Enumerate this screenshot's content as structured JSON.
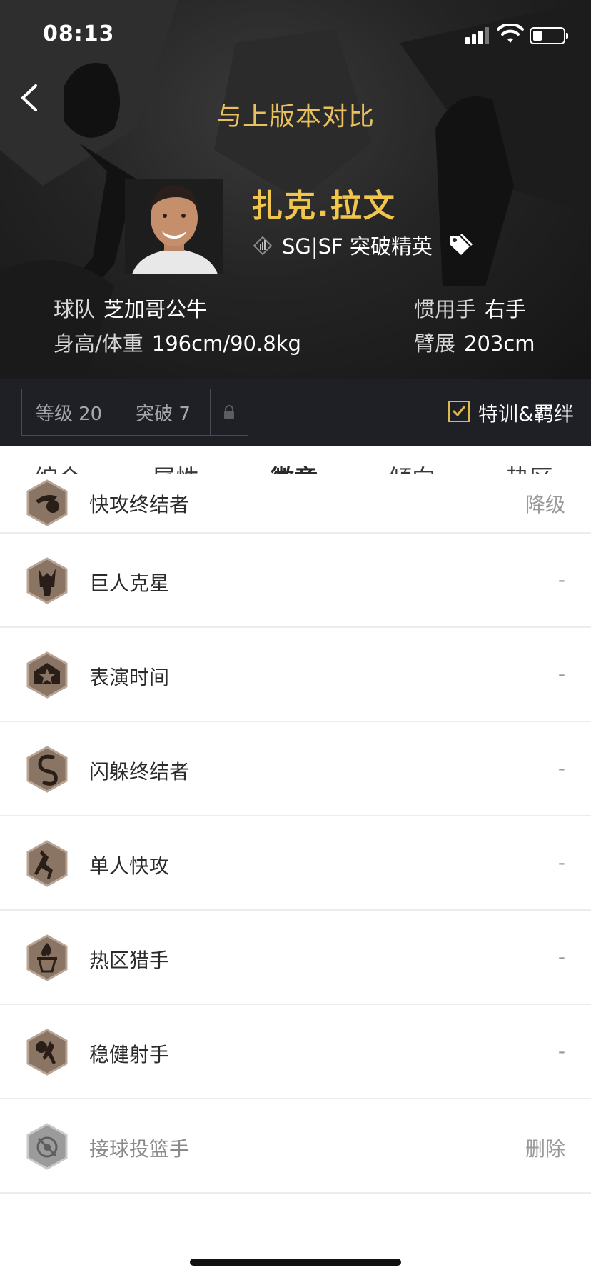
{
  "status_bar": {
    "time": "08:13"
  },
  "header": {
    "title": "与上版本对比",
    "player_name": "扎克.拉文",
    "position_text": "SG|SF 突破精英",
    "team_label": "球队",
    "team_value": "芝加哥公牛",
    "hw_label": "身高/体重",
    "hw_value": "196cm/90.8kg",
    "hand_label": "惯用手",
    "hand_value": "右手",
    "wingspan_label": "臂展",
    "wingspan_value": "203cm"
  },
  "level_bar": {
    "level": "等级 20",
    "breakthrough": "突破 7",
    "checkbox_label": "特训&羁绊",
    "checkbox_checked": true
  },
  "tabs": [
    "综合",
    "属性",
    "徽章",
    "倾向",
    "热区"
  ],
  "active_tab": "徽章",
  "badges": [
    {
      "name": "快攻终结者",
      "status": "降级",
      "icon": "fastbreak-finisher-icon"
    },
    {
      "name": "巨人克星",
      "status": "-",
      "icon": "giant-slayer-icon"
    },
    {
      "name": "表演时间",
      "status": "-",
      "icon": "showtime-icon"
    },
    {
      "name": "闪躲终结者",
      "status": "-",
      "icon": "acrobat-icon"
    },
    {
      "name": "单人快攻",
      "status": "-",
      "icon": "one-man-fastbreak-icon"
    },
    {
      "name": "热区猎手",
      "status": "-",
      "icon": "hot-zone-hunter-icon"
    },
    {
      "name": "稳健射手",
      "status": "-",
      "icon": "steady-shooter-icon"
    },
    {
      "name": "接球投篮手",
      "status": "删除",
      "icon": "catch-and-shoot-icon",
      "removed": true
    }
  ],
  "colors": {
    "accent_gold": "#f1c64d",
    "tab_underline": "#f0b93a",
    "header_bg": "#1f1f26",
    "badge_bronze": "#8a7464"
  }
}
